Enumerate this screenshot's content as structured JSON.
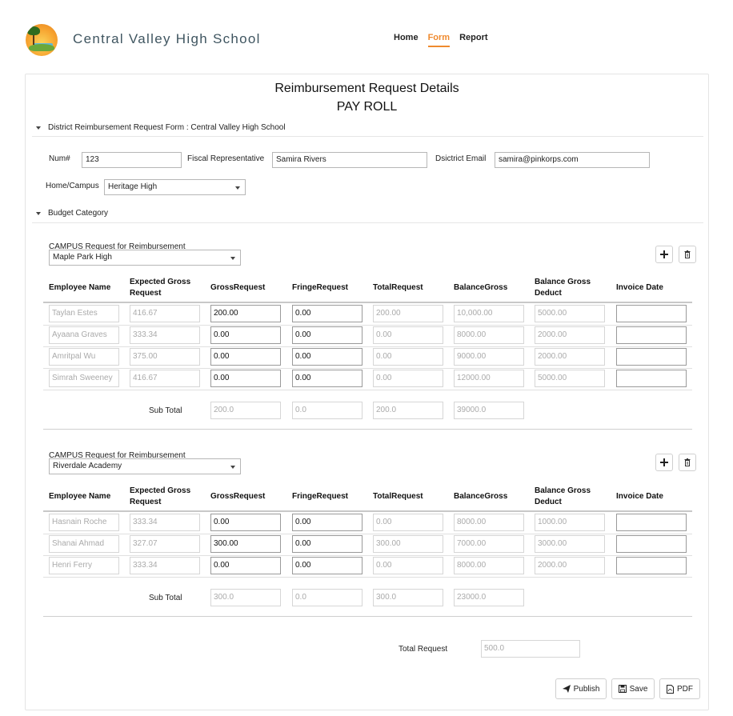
{
  "header": {
    "school_name": "Central Valley High School",
    "nav": [
      {
        "label": "Home",
        "active": false
      },
      {
        "label": "Form",
        "active": true
      },
      {
        "label": "Report",
        "active": false
      }
    ],
    "accent_color": "#ef8a2e"
  },
  "page": {
    "title": "Reimbursement Request Details",
    "subtitle": "PAY ROLL"
  },
  "district_section": {
    "heading": "District Reimbursement Request Form : Central Valley High School",
    "num_label": "Num#",
    "num_value": "123",
    "fiscal_label": "Fiscal Representative",
    "fiscal_value": "Samira Rivers",
    "email_label": "Dsictrict Email",
    "email_value": "samira@pinkorps.com",
    "campus_label": "Home/Campus",
    "campus_value": "Heritage High"
  },
  "budget_section": {
    "heading": "Budget Category",
    "columns": [
      "Employee Name",
      "Expected Gross Request",
      "GrossRequest",
      "FringeRequest",
      "TotalRequest",
      "BalanceGross",
      "Balance Gross Deduct",
      "Invoice Date"
    ],
    "subtotal_label": "Sub Total",
    "campuses": [
      {
        "request_label": "CAMPUS Request for Reimbursement",
        "campus": "Maple Park High",
        "rows": [
          [
            "Taylan Estes",
            "416.67",
            "200.00",
            "0.00",
            "200.00",
            "10,000.00",
            "5000.00",
            ""
          ],
          [
            "Ayaana Graves",
            "333.34",
            "0.00",
            "0.00",
            "0.00",
            "8000.00",
            "2000.00",
            ""
          ],
          [
            "Amritpal Wu",
            "375.00",
            "0.00",
            "0.00",
            "0.00",
            "9000.00",
            "2000.00",
            ""
          ],
          [
            "Simrah Sweeney",
            "416.67",
            "0.00",
            "0.00",
            "0.00",
            "12000.00",
            "5000.00",
            ""
          ]
        ],
        "subtotals": [
          "200.0",
          "0.0",
          "200.0",
          "39000.0"
        ]
      },
      {
        "request_label": "CAMPUS Request for Reimbursement",
        "campus": "Riverdale Academy",
        "rows": [
          [
            "Hasnain Roche",
            "333.34",
            "0.00",
            "0.00",
            "0.00",
            "8000.00",
            "1000.00",
            ""
          ],
          [
            "Shanai Ahmad",
            "327.07",
            "300.00",
            "0.00",
            "300.00",
            "7000.00",
            "3000.00",
            ""
          ],
          [
            "Henri Ferry",
            "333.34",
            "0.00",
            "0.00",
            "0.00",
            "8000.00",
            "2000.00",
            ""
          ]
        ],
        "subtotals": [
          "300.0",
          "0.0",
          "300.0",
          "23000.0"
        ]
      }
    ]
  },
  "totals": {
    "total_request_label": "Total Request",
    "total_request_value": "500.0"
  },
  "actions": {
    "publish_label": "Publish",
    "save_label": "Save",
    "pdf_label": "PDF"
  }
}
